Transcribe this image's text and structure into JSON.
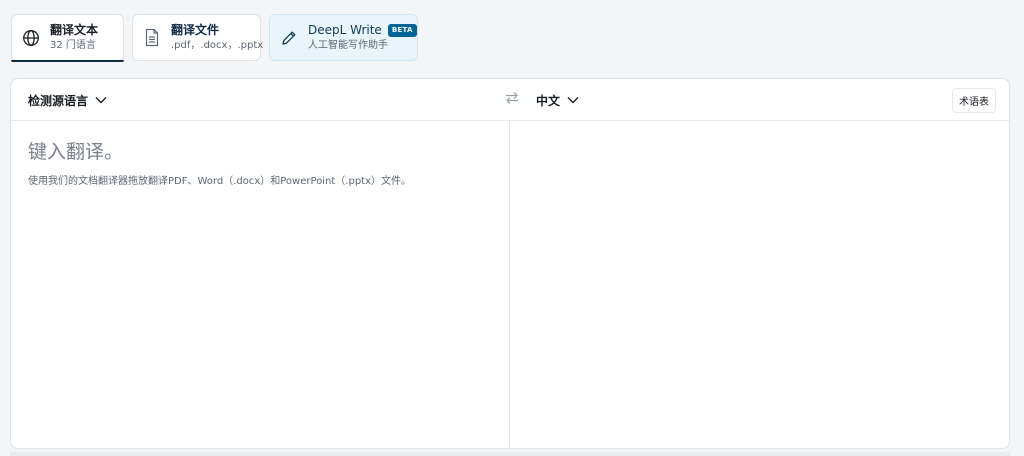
{
  "tabs": [
    {
      "title": "翻译文本",
      "subtitle": "32 门语言",
      "icon": "globe-icon"
    },
    {
      "title": "翻译文件",
      "subtitle": ".pdf，.docx，.pptx",
      "icon": "document-icon"
    },
    {
      "title": "DeepL Write",
      "badge": "BETA",
      "subtitle": "人工智能写作助手",
      "icon": "pencil-icon"
    }
  ],
  "translator": {
    "source_language": "检测源语言",
    "target_language": "中文",
    "glossary_label": "术语表",
    "source_placeholder": "键入翻译。",
    "source_hint": "使用我们的文档翻译器拖放翻译PDF、Word（.docx）和PowerPoint（.pptx）文件。",
    "icons": {
      "swap": "swap-arrows-icon",
      "chevron": "chevron-down-icon"
    }
  },
  "colors": {
    "accent": "#0f2b46",
    "beta_badge": "#006494",
    "write_tab_bg": "#e9f5fb",
    "page_bg": "#f3f5f7"
  }
}
